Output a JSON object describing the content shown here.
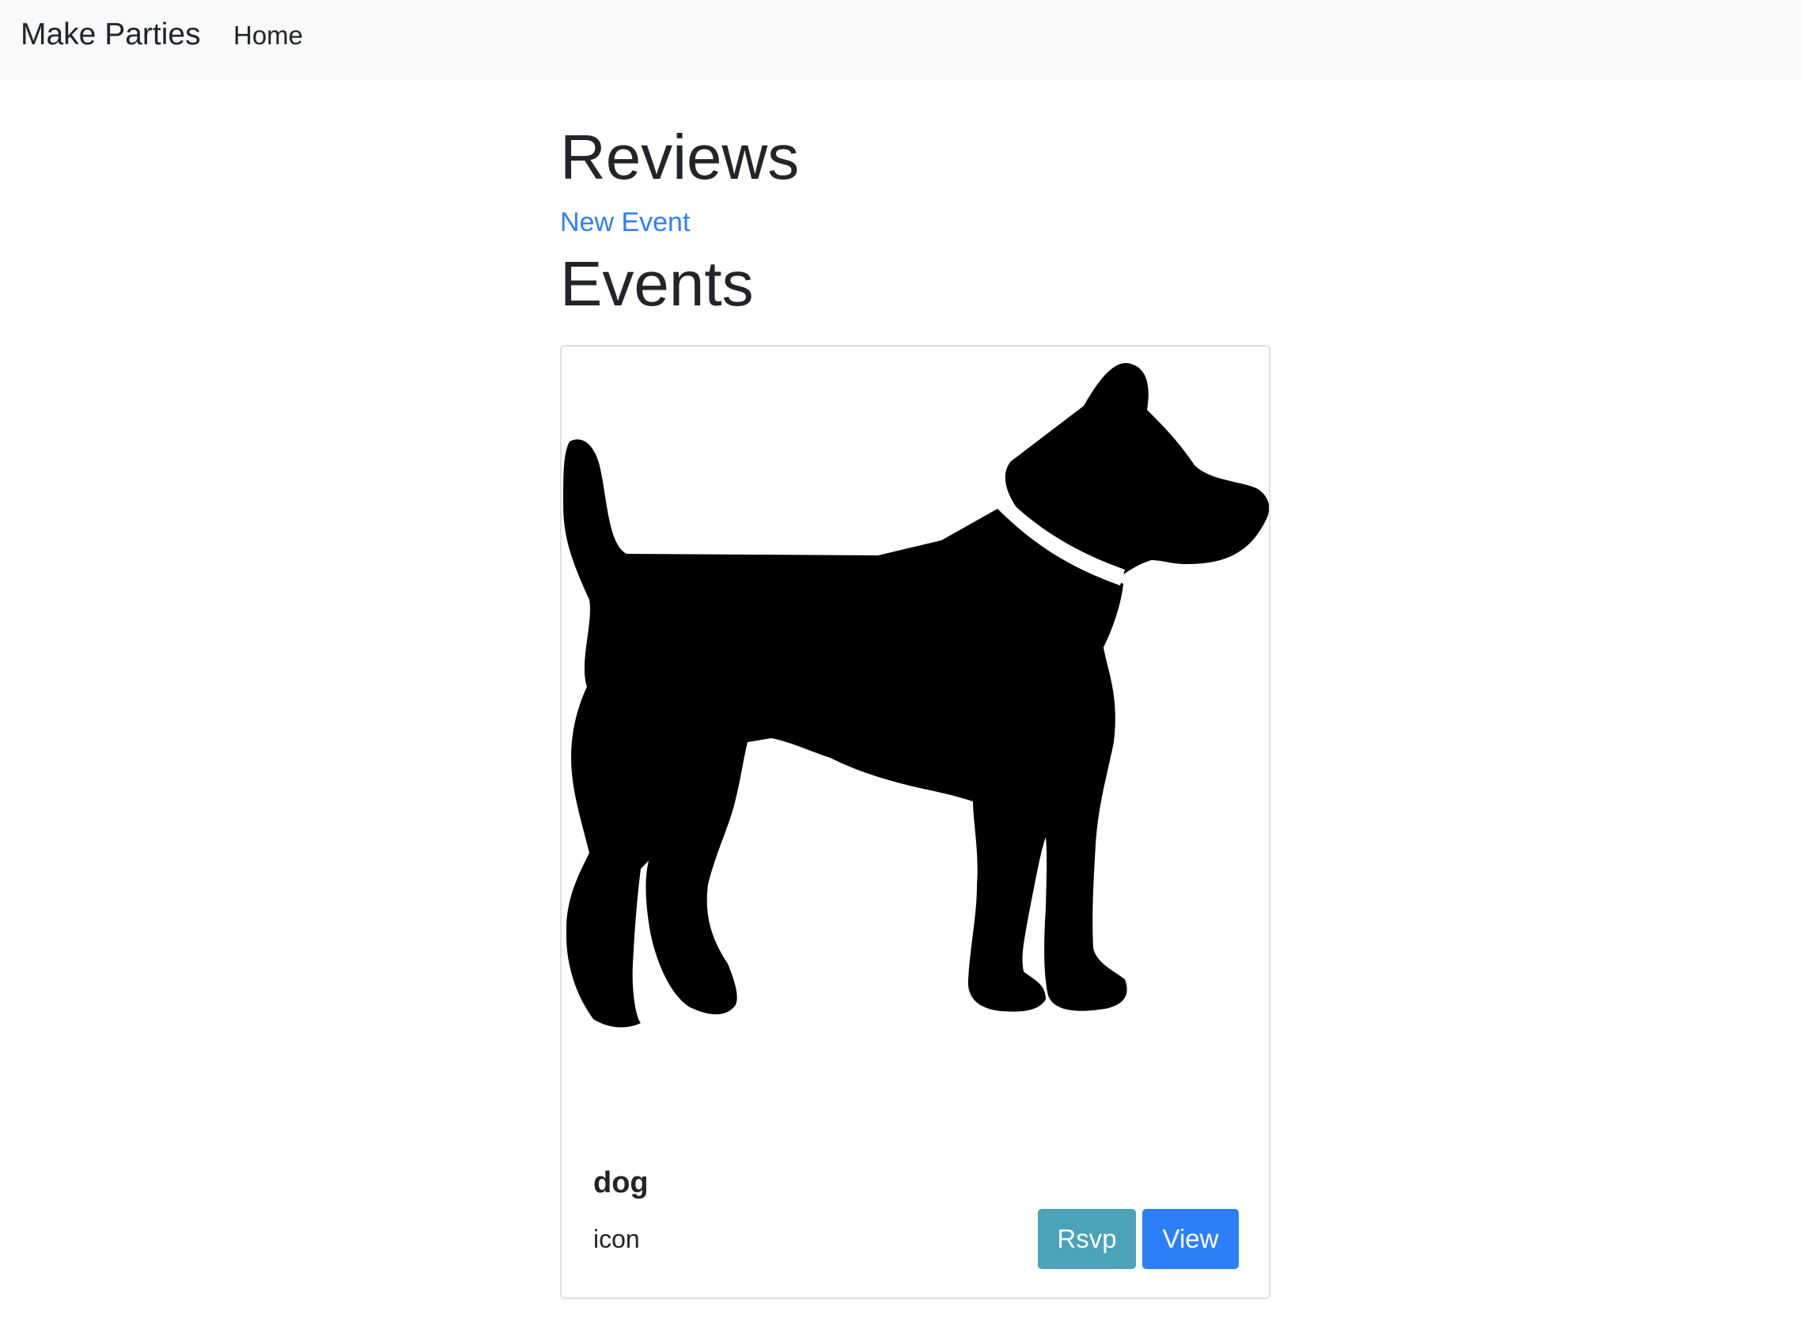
{
  "navbar": {
    "brand": "Make Parties",
    "links": [
      {
        "label": "Home"
      }
    ]
  },
  "main": {
    "reviews_heading": "Reviews",
    "new_event_link": "New Event",
    "events_heading": "Events"
  },
  "events": [
    {
      "image_icon": "dog-silhouette-icon",
      "title": "dog",
      "description": "icon",
      "rsvp_label": "Rsvp",
      "view_label": "View"
    }
  ],
  "colors": {
    "navbar_bg": "#f8f9fa",
    "link": "#2d7ff9",
    "rsvp_button": "#4aa3b8",
    "view_button": "#2d7ff9"
  }
}
